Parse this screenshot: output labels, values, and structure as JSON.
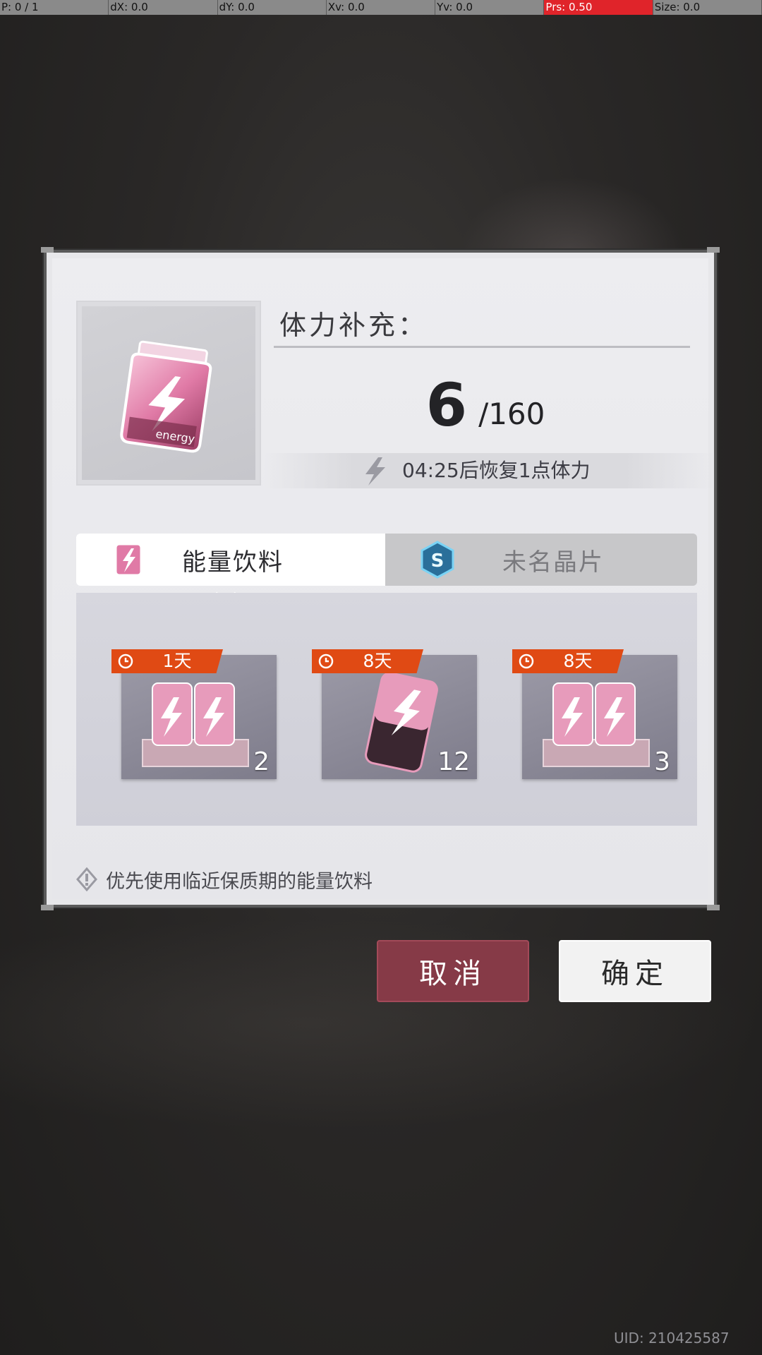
{
  "debug_bar": {
    "p": "P: 0 / 1",
    "dx": "dX: 0.0",
    "dy": "dY: 0.0",
    "xv": "Xv: 0.0",
    "yv": "Yv: 0.0",
    "prs": "Prs: 0.50",
    "size": "Size: 0.0"
  },
  "dialog": {
    "title": "体力补充：",
    "stamina_current": "6",
    "stamina_max": "/160",
    "recover_text": "04:25后恢复1点体力",
    "item_icon": "energy-drink-jar-icon",
    "item_icon_label": "energy"
  },
  "tabs": [
    {
      "label": "能量饮料",
      "icon": "energy-drink-icon",
      "active": true
    },
    {
      "label": "未名晶片",
      "icon": "s-chip-icon",
      "active": false
    }
  ],
  "items": [
    {
      "badge": "1天",
      "count": "2",
      "icon": "double-energy-can-icon"
    },
    {
      "badge": "8天",
      "count": "12",
      "icon": "single-energy-can-icon"
    },
    {
      "badge": "8天",
      "count": "3",
      "icon": "double-energy-can-icon"
    }
  ],
  "tip": "优先使用临近保质期的能量饮料",
  "buttons": {
    "cancel": "取消",
    "confirm": "确定"
  },
  "uid": "UID: 210425587",
  "colors": {
    "badge": "#e04a14",
    "cancel_button": "#863a47",
    "confirm_button": "#f2f2f2",
    "accent_pink": "#e86aa0"
  }
}
